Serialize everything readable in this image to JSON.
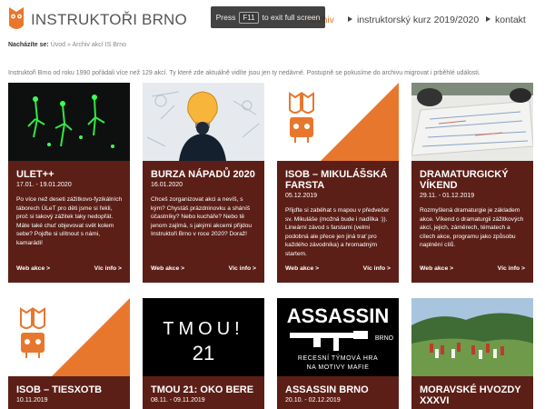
{
  "header": {
    "brand": "INSTRUKTOŘI BRNO",
    "nav": [
      {
        "label": "archiv",
        "active": true
      },
      {
        "label": "instruktorský kurz 2019/2020",
        "active": false
      },
      {
        "label": "kontakt",
        "active": false
      }
    ]
  },
  "fullscreen_banner": {
    "before": "Press",
    "key": "F11",
    "after": "to exit full screen"
  },
  "breadcrumb": {
    "label": "Nacházíte se:",
    "home": "Úvod",
    "separator": "»",
    "current": "Archiv akcí IS Brno"
  },
  "intro": "Instruktoři Brno od roku 1990 pořádali více než 129 akcí. Ty které zde aktuálně vidíte jsou jen ty nedávné. Postupně se pokusíme do archivu migrovat i prběhlé události.",
  "card_links": {
    "web": "Web akce >",
    "info": "Víc info >"
  },
  "cards": [
    {
      "title": "ULET++",
      "date": "17.01. - 19.01.2020",
      "description": "Po více než deseti zážitkovo-fyzikálních táborech ÚLeT pro děti jsme si řekli, proč si takový zážitek taky nedopřát. Máte také chuť objevovat svět kolem sebe? Pojďte si ulítnout s námi, kamarádi!"
    },
    {
      "title": "BURZA NÁPADŮ 2020",
      "date": "16.01.2020",
      "description": "Chceš zorganizovat akci a nevíš, s kým? Chystáš prázdninovku a sháníš účastníky? Nebo kucháře? Nebo tě jenom zajímá, s jakými akcemi přijdou Instruktoři Brno v roce 2020? Doraž!"
    },
    {
      "title": "ISOB – MIKULÁŠSKÁ FARSTA",
      "date": "05.12.2019",
      "description": "Přijďte si zaběhat s mapou v předvečer sv. Mikuláše (možná bude i nadílka :)). Lineární závod s farstami (velmi podobná ale přece jen jiná trať pro každého závodníka) a hromadným startem."
    },
    {
      "title": "DRAMATURGICKÝ VÍKEND",
      "date": "29.11. - 01.12.2019",
      "description": "Rozmyšlená dramaturgie je základem akce. Víkend o dramaturgii zážitkových akcí, jejich, záměrech, tématech a cílech akce, programu jako způsobu naplnění cílů."
    },
    {
      "title": "ISOB – TIESXOTB",
      "date": "10.11.2019"
    },
    {
      "title": "TMOU 21: OKO BERE",
      "date": "08.11. - 09.11.2019",
      "image_text": {
        "line1": "TMOU!",
        "line2": "21"
      }
    },
    {
      "title": "ASSASSIN BRNO",
      "date": "20.10. - 02.12.2019",
      "image_text": {
        "title": "ASSASSIN",
        "sub": "BRNO",
        "tagline1": "RECESNÍ TÝMOVÁ HRA",
        "tagline2": "NA MOTIVY MAFIE"
      }
    },
    {
      "title": "MORAVSKÉ HVOZDY XXXVI",
      "date": ""
    }
  ],
  "colors": {
    "accent": "#e8772e",
    "card_bg": "#5c1f17",
    "text": "#333333"
  },
  "icons": [
    "owl-logo-icon",
    "lightbulb-icon",
    "person-silhouette-icon",
    "rifle-icon"
  ]
}
